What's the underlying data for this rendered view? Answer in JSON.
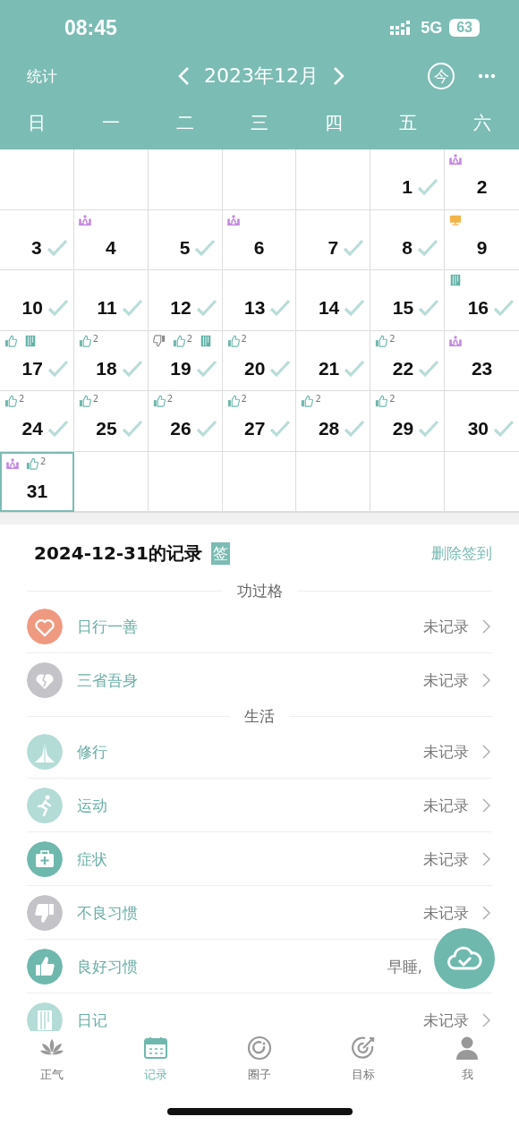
{
  "status_bar": {
    "time": "08:45",
    "network": "5G",
    "battery": "63"
  },
  "header": {
    "left": "统计",
    "title": "2023年12月",
    "today": "今"
  },
  "weekdays": [
    "日",
    "一",
    "二",
    "三",
    "四",
    "五",
    "六"
  ],
  "weeks": [
    [
      {
        "kind": "blank"
      },
      {
        "kind": "blank"
      },
      {
        "kind": "blank"
      },
      {
        "kind": "blank"
      },
      {
        "kind": "blank"
      },
      {
        "kind": "day",
        "day": "1",
        "checked": true,
        "selected": false
      },
      {
        "kind": "day",
        "day": "2",
        "checked": false,
        "selected": false,
        "marks": [
          {
            "kind": "meditate"
          }
        ]
      }
    ],
    [
      {
        "kind": "day",
        "day": "3",
        "checked": true,
        "selected": false
      },
      {
        "kind": "day",
        "day": "4",
        "checked": false,
        "selected": false,
        "marks": [
          {
            "kind": "meditate"
          }
        ]
      },
      {
        "kind": "day",
        "day": "5",
        "checked": true,
        "selected": false
      },
      {
        "kind": "day",
        "day": "6",
        "checked": false,
        "selected": false,
        "marks": [
          {
            "kind": "meditate"
          }
        ]
      },
      {
        "kind": "day",
        "day": "7",
        "checked": true,
        "selected": false
      },
      {
        "kind": "day",
        "day": "8",
        "checked": true,
        "selected": false
      },
      {
        "kind": "day",
        "day": "9",
        "checked": false,
        "selected": false,
        "marks": [
          {
            "kind": "screen"
          }
        ]
      }
    ],
    [
      {
        "kind": "day",
        "day": "10",
        "checked": true,
        "selected": false
      },
      {
        "kind": "day",
        "day": "11",
        "checked": true,
        "selected": false
      },
      {
        "kind": "day",
        "day": "12",
        "checked": true,
        "selected": false
      },
      {
        "kind": "day",
        "day": "13",
        "checked": true,
        "selected": false
      },
      {
        "kind": "day",
        "day": "14",
        "checked": true,
        "selected": false
      },
      {
        "kind": "day",
        "day": "15",
        "checked": true,
        "selected": false
      },
      {
        "kind": "day",
        "day": "16",
        "checked": true,
        "selected": false,
        "marks": [
          {
            "kind": "book"
          }
        ]
      }
    ],
    [
      {
        "kind": "day",
        "day": "17",
        "checked": true,
        "selected": false,
        "marks": [
          {
            "kind": "thumb_up"
          },
          {
            "kind": "book"
          }
        ]
      },
      {
        "kind": "day",
        "day": "18",
        "checked": true,
        "selected": false,
        "marks": [
          {
            "kind": "thumb_up",
            "count": "2"
          }
        ]
      },
      {
        "kind": "day",
        "day": "19",
        "checked": true,
        "selected": false,
        "marks": [
          {
            "kind": "thumb_down"
          },
          {
            "kind": "thumb_up",
            "count": "2"
          },
          {
            "kind": "book"
          }
        ]
      },
      {
        "kind": "day",
        "day": "20",
        "checked": true,
        "selected": false,
        "marks": [
          {
            "kind": "thumb_up",
            "count": "2"
          }
        ]
      },
      {
        "kind": "day",
        "day": "21",
        "checked": true,
        "selected": false
      },
      {
        "kind": "day",
        "day": "22",
        "checked": true,
        "selected": false,
        "marks": [
          {
            "kind": "thumb_up",
            "count": "2"
          }
        ]
      },
      {
        "kind": "day",
        "day": "23",
        "checked": false,
        "selected": false,
        "marks": [
          {
            "kind": "meditate"
          }
        ]
      }
    ],
    [
      {
        "kind": "day",
        "day": "24",
        "checked": true,
        "selected": false,
        "marks": [
          {
            "kind": "thumb_up",
            "count": "2"
          }
        ]
      },
      {
        "kind": "day",
        "day": "25",
        "checked": true,
        "selected": false,
        "marks": [
          {
            "kind": "thumb_up",
            "count": "2"
          }
        ]
      },
      {
        "kind": "day",
        "day": "26",
        "checked": true,
        "selected": false,
        "marks": [
          {
            "kind": "thumb_up",
            "count": "2"
          }
        ]
      },
      {
        "kind": "day",
        "day": "27",
        "checked": true,
        "selected": false,
        "marks": [
          {
            "kind": "thumb_up",
            "count": "2"
          }
        ]
      },
      {
        "kind": "day",
        "day": "28",
        "checked": true,
        "selected": false,
        "marks": [
          {
            "kind": "thumb_up",
            "count": "2"
          }
        ]
      },
      {
        "kind": "day",
        "day": "29",
        "checked": true,
        "selected": false,
        "marks": [
          {
            "kind": "thumb_up",
            "count": "2"
          }
        ]
      },
      {
        "kind": "day",
        "day": "30",
        "checked": true,
        "selected": false
      }
    ],
    [
      {
        "kind": "day",
        "day": "31",
        "checked": false,
        "selected": true,
        "marks": [
          {
            "kind": "meditate"
          },
          {
            "kind": "thumb_up",
            "count": "2"
          }
        ]
      },
      {
        "kind": "blank"
      },
      {
        "kind": "blank"
      },
      {
        "kind": "blank"
      },
      {
        "kind": "blank"
      },
      {
        "kind": "blank"
      },
      {
        "kind": "blank"
      }
    ]
  ],
  "record": {
    "title": "2024-12-31的记录",
    "badge": "签",
    "action": "删除签到",
    "groups": [
      {
        "title": "功过格",
        "items": [
          {
            "kind": "heart",
            "color": "#ef9a80",
            "label": "日行一善",
            "value": "未记录",
            "chevron": true
          },
          {
            "kind": "broken_heart",
            "color": "#c4c4c8",
            "label": "三省吾身",
            "value": "未记录",
            "chevron": true
          }
        ]
      },
      {
        "title": "生活",
        "items": [
          {
            "kind": "hands",
            "color": "#b3dcd7",
            "label": "修行",
            "value": "未记录",
            "chevron": true
          },
          {
            "kind": "run",
            "color": "#b3dcd7",
            "label": "运动",
            "value": "未记录",
            "chevron": true
          },
          {
            "kind": "medkit",
            "color": "#6fb8ae",
            "label": "症状",
            "value": "未记录",
            "chevron": true
          },
          {
            "kind": "thumb_down",
            "color": "#c4c4c8",
            "label": "不良习惯",
            "value": "未记录",
            "chevron": true
          },
          {
            "kind": "thumb_up",
            "color": "#6fb8ae",
            "label": "良好习惯",
            "value": "早睡,",
            "chevron": false
          },
          {
            "kind": "diary",
            "color": "#b3dcd7",
            "label": "日记",
            "value": "未记录",
            "chevron": true
          }
        ]
      }
    ]
  },
  "tabs": [
    {
      "kind": "lotus",
      "label": "正气",
      "selected": false
    },
    {
      "kind": "calendar",
      "label": "记录",
      "selected": true
    },
    {
      "kind": "circle",
      "label": "圈子",
      "selected": false
    },
    {
      "kind": "target",
      "label": "目标",
      "selected": false
    },
    {
      "kind": "person",
      "label": "我",
      "selected": false
    }
  ]
}
